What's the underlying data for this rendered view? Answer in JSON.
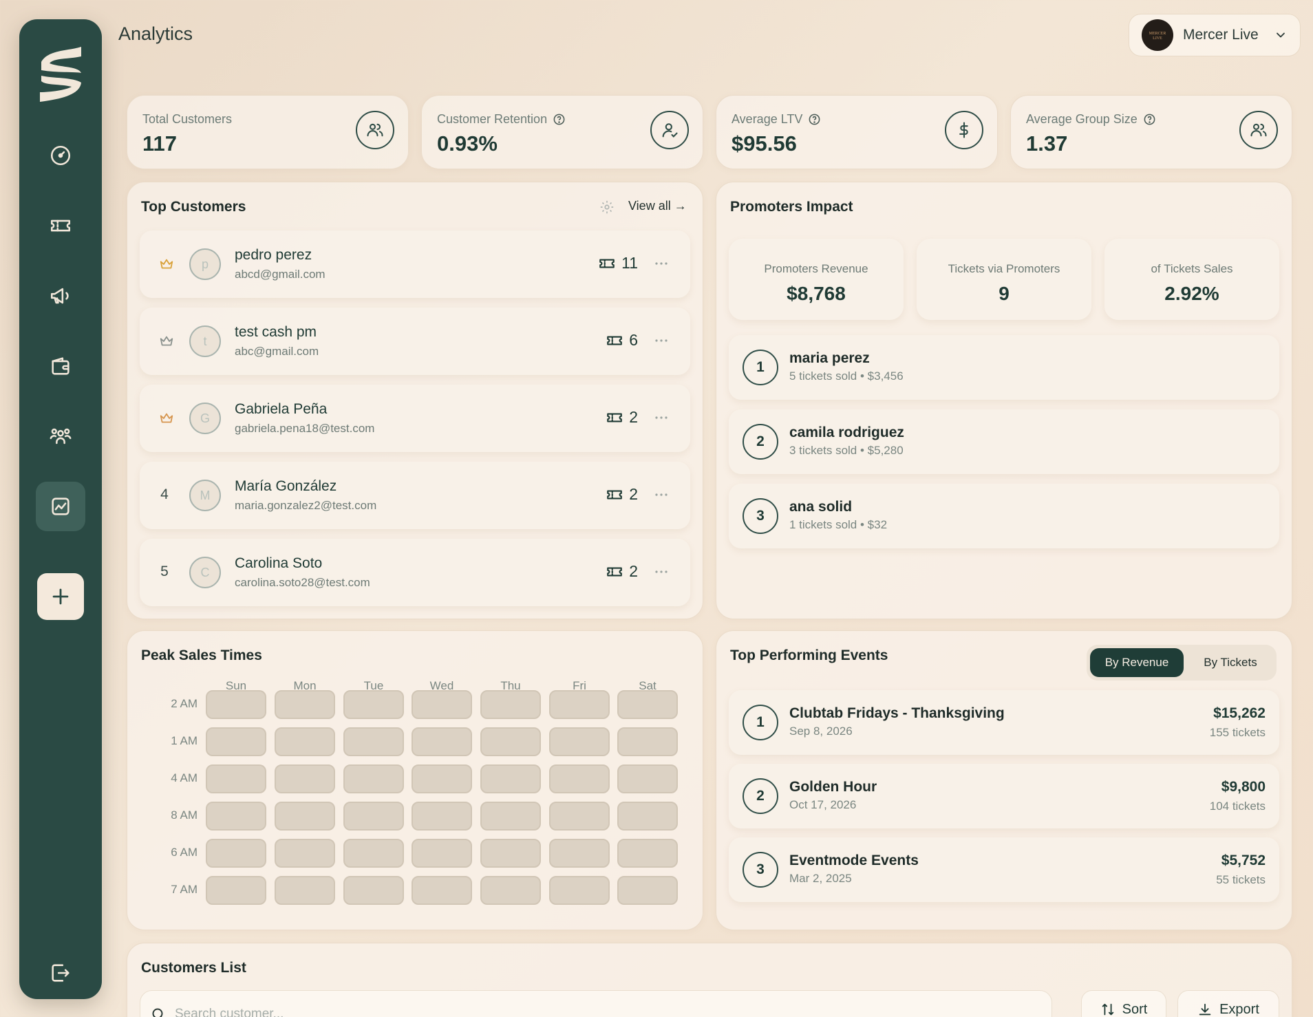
{
  "header": {
    "title": "Analytics",
    "account_name": "Mercer Live",
    "account_logo_text": "MERCER LIVE"
  },
  "stats": [
    {
      "label": "Total Customers",
      "value": "117",
      "icon": "users-icon",
      "has_help": false
    },
    {
      "label": "Customer Retention",
      "value": "0.93%",
      "icon": "user-check-icon",
      "has_help": true
    },
    {
      "label": "Average LTV",
      "value": "$95.56",
      "icon": "dollar-icon",
      "has_help": true
    },
    {
      "label": "Average Group Size",
      "value": "1.37",
      "icon": "users-icon",
      "has_help": true
    }
  ],
  "top_customers": {
    "title": "Top Customers",
    "view_all": "View all →",
    "items": [
      {
        "rank": "1",
        "crown": "gold",
        "initial": "p",
        "name": "pedro perez",
        "email": "abcd@gmail.com",
        "tickets": "11"
      },
      {
        "rank": "2",
        "crown": "silver",
        "initial": "t",
        "name": "test cash pm",
        "email": "abc@gmail.com",
        "tickets": "6"
      },
      {
        "rank": "3",
        "crown": "bronze",
        "initial": "G",
        "name": "Gabriela Peña",
        "email": "gabriela.pena18@test.com",
        "tickets": "2"
      },
      {
        "rank": "4",
        "crown": "",
        "initial": "M",
        "name": "María González",
        "email": "maria.gonzalez2@test.com",
        "tickets": "2"
      },
      {
        "rank": "5",
        "crown": "",
        "initial": "C",
        "name": "Carolina Soto",
        "email": "carolina.soto28@test.com",
        "tickets": "2"
      }
    ]
  },
  "promoters": {
    "title": "Promoters Impact",
    "stats": [
      {
        "label": "Promoters Revenue",
        "value": "$8,768"
      },
      {
        "label": "Tickets via Promoters",
        "value": "9"
      },
      {
        "label": "of Tickets Sales",
        "value": "2.92%"
      }
    ],
    "items": [
      {
        "rank": "1",
        "name": "maria perez",
        "sub": "5 tickets sold • $3,456"
      },
      {
        "rank": "2",
        "name": "camila rodriguez",
        "sub": "3 tickets sold • $5,280"
      },
      {
        "rank": "3",
        "name": "ana solid",
        "sub": "1 tickets sold • $32"
      }
    ]
  },
  "peak_sales": {
    "title": "Peak Sales Times",
    "days": [
      "Sun",
      "Mon",
      "Tue",
      "Wed",
      "Thu",
      "Fri",
      "Sat"
    ],
    "times": [
      "2 AM",
      "1 AM",
      "4 AM",
      "8 AM",
      "6 AM",
      "7 AM"
    ]
  },
  "top_events": {
    "title": "Top Performing Events",
    "tabs": {
      "by_revenue": "By Revenue",
      "by_tickets": "By Tickets",
      "active": "by_revenue"
    },
    "items": [
      {
        "rank": "1",
        "name": "Clubtab Fridays - Thanksgiving",
        "date": "Sep 8, 2026",
        "revenue": "$15,262",
        "tickets": "155 tickets"
      },
      {
        "rank": "2",
        "name": "Golden Hour",
        "date": "Oct 17, 2026",
        "revenue": "$9,800",
        "tickets": "104 tickets"
      },
      {
        "rank": "3",
        "name": "Eventmode Events",
        "date": "Mar 2, 2025",
        "revenue": "$5,752",
        "tickets": "55 tickets"
      }
    ]
  },
  "customers_list": {
    "title": "Customers List",
    "search_placeholder": "Search customer...",
    "sort_label": "Sort",
    "export_label": "Export"
  },
  "colors": {
    "sidebar": "#2a4a44",
    "accent_dark": "#1f3d37",
    "crown_gold": "#d9a23a",
    "crown_silver": "#8a918d",
    "crown_bronze": "#d6954e"
  }
}
